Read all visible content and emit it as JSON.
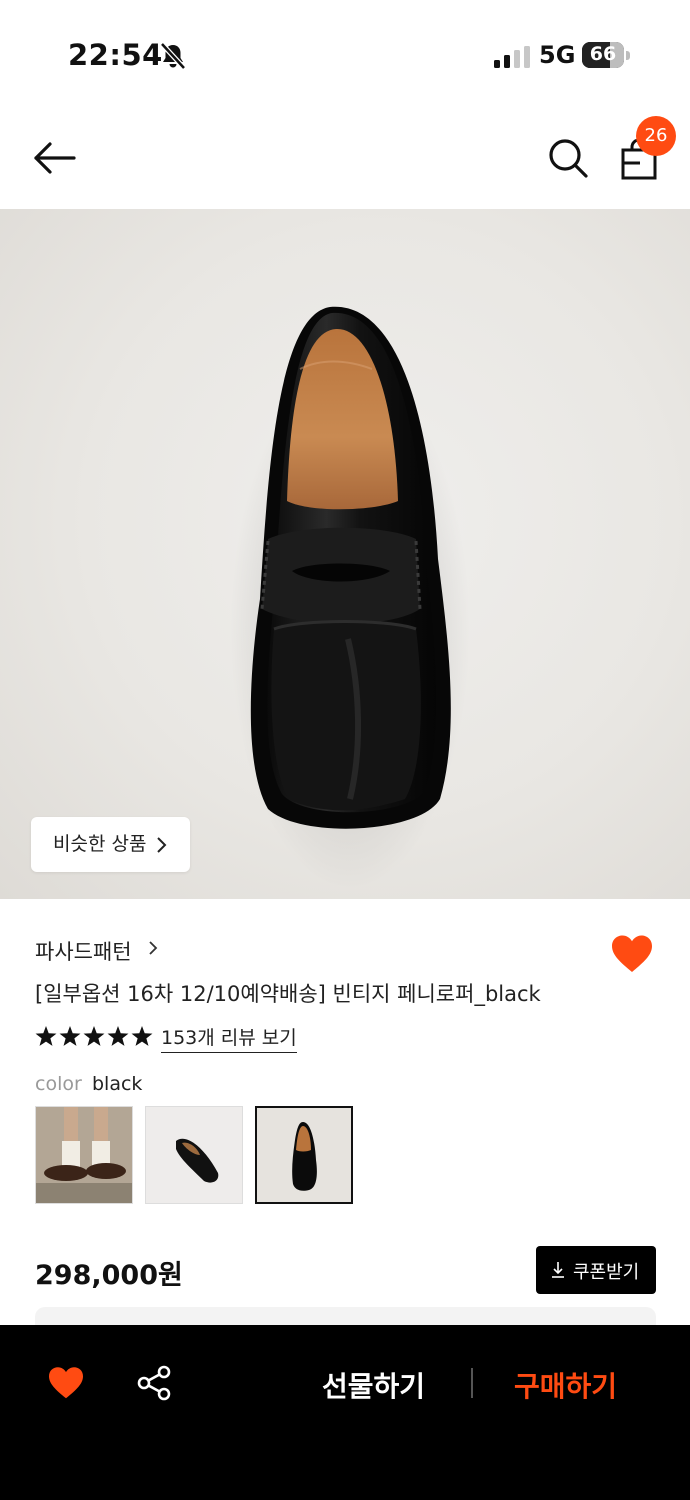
{
  "status_bar": {
    "time": "22:54",
    "network": "5G",
    "battery": "66",
    "battery_level": 0.66
  },
  "header": {
    "cart_count": "26"
  },
  "product": {
    "similar_label": "비슷한 상품",
    "brand": "파사드패턴",
    "name": "[일부옵션 16차 12/10예약배송] 빈티지 페니로퍼_black",
    "rating": 5,
    "reviews_label": "153개 리뷰 보기",
    "color_label": "color",
    "color_value": "black",
    "swatches": [
      "model-worn",
      "side-view",
      "top-view"
    ],
    "selected_swatch": 2,
    "price": "298,000원",
    "coupon_label": "쿠폰받기"
  },
  "bottom_bar": {
    "gift_label": "선물하기",
    "buy_label": "구매하기"
  },
  "colors": {
    "accent": "#ff4b12",
    "black": "#000000"
  },
  "icons": [
    "bell-off-icon",
    "signal-icon",
    "battery-icon",
    "back-arrow-icon",
    "search-icon",
    "shopping-bag-icon",
    "chevron-right-icon",
    "heart-icon",
    "star-icon",
    "download-icon",
    "share-icon"
  ]
}
